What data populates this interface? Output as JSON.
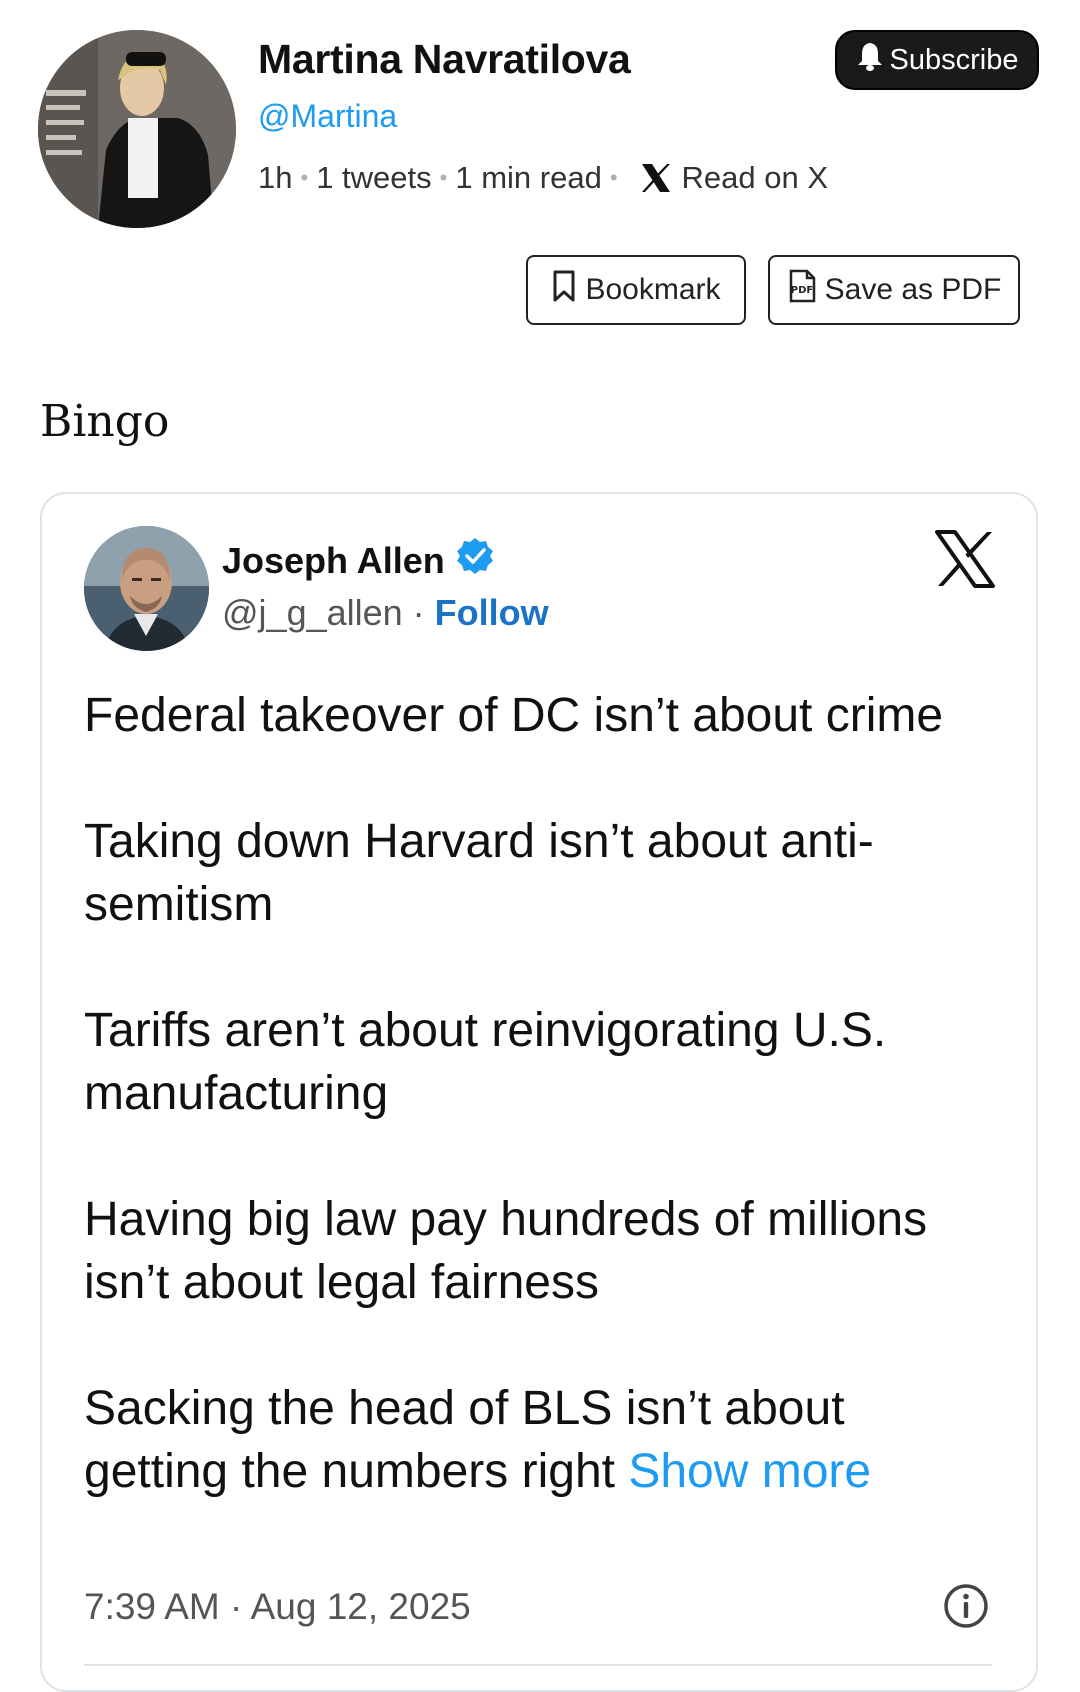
{
  "author": {
    "name": "Martina Navratilova",
    "handle": "@Martina"
  },
  "meta": {
    "age": "1h",
    "tweets": "1 tweets",
    "read_time": "1 min read",
    "read_on_x": "Read on X"
  },
  "buttons": {
    "subscribe": "Subscribe",
    "bookmark": "Bookmark",
    "save_pdf": "Save as PDF"
  },
  "post_text": "Bingo",
  "quoted_tweet": {
    "name": "Joseph Allen",
    "handle": "@j_g_allen",
    "separator": " · ",
    "follow": "Follow",
    "paragraphs": [
      "Federal takeover of DC isn’t about crime",
      "Taking down Harvard isn’t about anti-semitism",
      "Tariffs aren’t about reinvigorating U.S. manufacturing",
      "Having big law pay hundreds of millions isn’t about legal fairness",
      "Sacking the head of BLS isn’t about getting the numbers right"
    ],
    "show_more": "Show more",
    "timestamp": "7:39 AM · Aug 12, 2025"
  },
  "icons": {
    "verified": "verified-badge-icon",
    "x_logo": "x-logo-icon",
    "info": "info-icon",
    "bell": "bell-icon",
    "bookmark": "bookmark-icon",
    "pdf": "pdf-icon"
  },
  "colors": {
    "link_blue": "#1d9bf0",
    "follow_blue": "#1a73c7",
    "subscribe_bg": "#1a1a1a"
  }
}
